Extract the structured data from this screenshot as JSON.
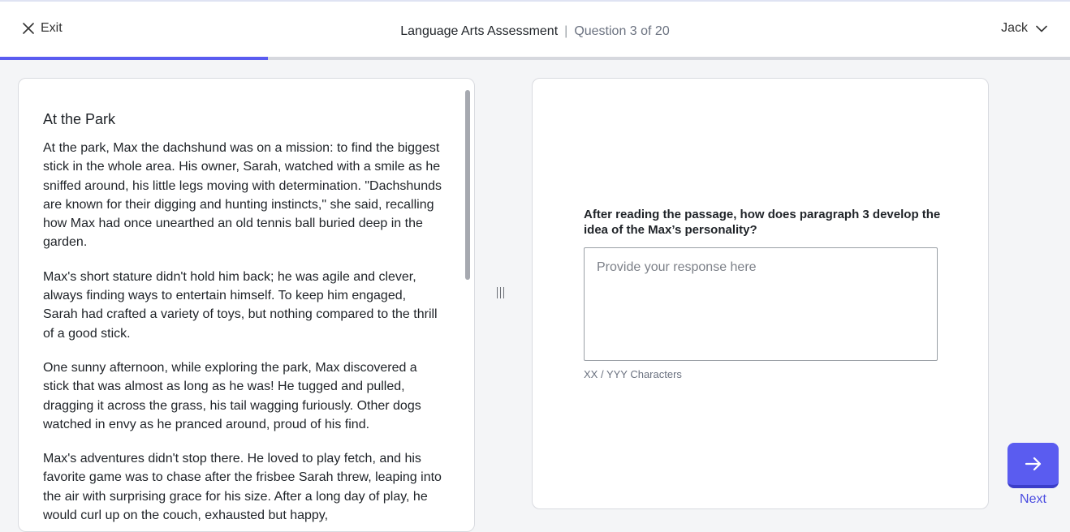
{
  "header": {
    "exit_label": "Exit",
    "assessment_title": "Language Arts Assessment",
    "separator": "|",
    "question_progress": "Question 3 of 20",
    "user_name": "Jack",
    "progress_fraction": 0.25
  },
  "passage": {
    "title": "At the Park",
    "paragraphs": [
      "At the park, Max the dachshund was on a mission: to find the biggest stick in the whole area. His owner, Sarah, watched with a smile as he sniffed around, his little legs moving with determination. \"Dachshunds are known for their digging and hunting instincts,\" she said, recalling how Max had once unearthed an old tennis ball buried deep in the garden.",
      "Max's short stature didn't hold him back; he was agile and clever, always finding ways to entertain himself. To keep him engaged, Sarah had crafted a variety of toys, but nothing compared to the thrill of a good stick.",
      "One sunny afternoon, while exploring the park, Max discovered a stick that was almost as long as he was! He tugged and pulled, dragging it across the grass, his tail wagging furiously. Other dogs watched in envy as he pranced around, proud of his find.",
      "Max's adventures didn't stop there. He loved to play fetch, and his favorite game was to chase after the frisbee Sarah threw, leaping into the air with surprising grace for his size. After a long day of play, he would curl up on the couch, exhausted but happy,"
    ]
  },
  "question": {
    "prompt": "After reading the passage, how does paragraph 3 develop the idea of the Max’s personality?",
    "response_value": "",
    "response_placeholder": "Provide your response here",
    "char_count": "XX / YYY Characters"
  },
  "nav": {
    "next_label": "Next"
  },
  "colors": {
    "accent": "#5a5cf0",
    "accent_dark": "#3b3dc9",
    "background": "#f4f5f7"
  },
  "icons": {
    "exit": "close-icon",
    "user_menu": "chevron-down-icon",
    "next": "arrow-right-icon",
    "divider": "drag-handle-icon"
  }
}
